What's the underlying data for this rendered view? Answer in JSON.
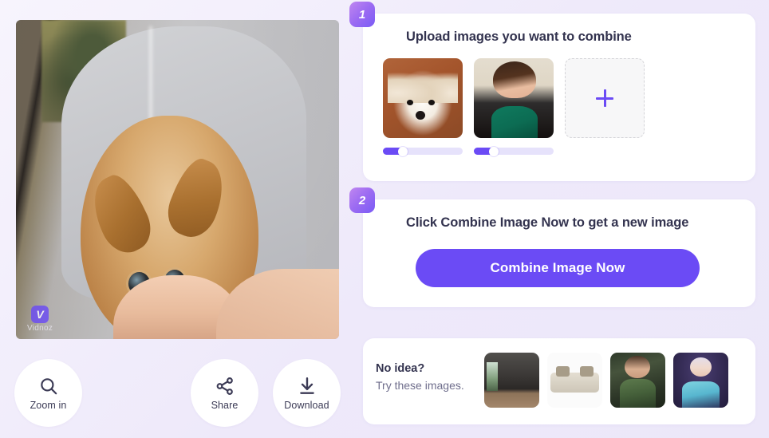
{
  "colors": {
    "page_background": "#eeeafa",
    "accent_purple": "#6b4bf5",
    "badge_gradient_start": "#c087f0",
    "badge_gradient_end": "#7a5bf5",
    "heading_text": "#33334f",
    "muted_text": "#6f6e8c",
    "card_background": "#ffffff"
  },
  "preview": {
    "alt": "combined-result-image",
    "watermark": {
      "logo_letter": "V",
      "brand": "Vidnoz"
    }
  },
  "actions": [
    {
      "id": "zoom-in",
      "label": "Zoom in",
      "icon": "search-icon"
    },
    {
      "id": "share",
      "label": "Share",
      "icon": "share-icon"
    },
    {
      "id": "download",
      "label": "Download",
      "icon": "download-icon"
    }
  ],
  "steps": {
    "upload": {
      "number": "1",
      "title": "Upload images you want to combine",
      "thumbnails": [
        {
          "id": "thumb-fennec-fox",
          "alt": "fennec-fox-photo",
          "slider_value": 25
        },
        {
          "id": "thumb-woman-portrait",
          "alt": "woman-portrait-photo",
          "slider_value": 25
        }
      ],
      "add_button": {
        "icon": "plus-icon",
        "label": ""
      }
    },
    "combine": {
      "number": "2",
      "title": "Click Combine Image Now to get a new image",
      "button_label": "Combine Image Now"
    }
  },
  "samples": {
    "title": "No idea?",
    "subtitle": "Try these images.",
    "items": [
      {
        "id": "sample-dark-room",
        "alt": "dark-room-interior"
      },
      {
        "id": "sample-sofa",
        "alt": "beige-fabric-sofa"
      },
      {
        "id": "sample-fantasy-woman",
        "alt": "fantasy-woman-green-dress"
      },
      {
        "id": "sample-animated-character",
        "alt": "animated-ice-character"
      }
    ]
  }
}
